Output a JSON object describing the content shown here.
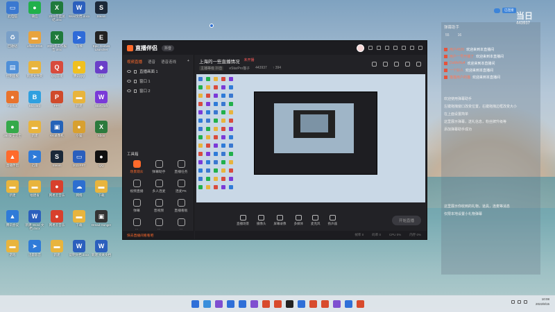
{
  "desktop": {
    "icons": [
      {
        "label": "此电脑",
        "color": "#3a78d0",
        "glyph": "▭"
      },
      {
        "label": "微信",
        "color": "#21b04b",
        "glyph": "●"
      },
      {
        "label": "2022年度总结.xlsx",
        "color": "#1f7a3c",
        "glyph": "X"
      },
      {
        "label": "Word文档.docx",
        "color": "#2b5fbd",
        "glyph": "W"
      },
      {
        "label": "Steam",
        "color": "#1b2838",
        "glyph": "S"
      },
      {
        "label": "回收站",
        "color": "#7aa0c8",
        "glyph": "♻"
      },
      {
        "label": "office 2016",
        "color": "#e8a33d",
        "glyph": "▬"
      },
      {
        "label": "2022年工作报告.xlsx",
        "color": "#1f7a3c",
        "glyph": "X"
      },
      {
        "label": "飞书",
        "color": "#2f6bd8",
        "glyph": "➤"
      },
      {
        "label": "Epic Games Launcher",
        "color": "#222",
        "glyph": "E"
      },
      {
        "label": "控制面板",
        "color": "#4f8fd8",
        "glyph": "▤"
      },
      {
        "label": "新建文件夹",
        "color": "#e8b43d",
        "glyph": "▬"
      },
      {
        "label": "QQ游戏",
        "color": "#d84b3d",
        "glyph": "Q"
      },
      {
        "label": "腾讯QQ",
        "color": "#f0c020",
        "glyph": "●"
      },
      {
        "label": "XXX",
        "color": "#6a3fc8",
        "glyph": "◆"
      },
      {
        "label": "Firefox",
        "color": "#e8732d",
        "glyph": "●"
      },
      {
        "label": "Blizzard",
        "color": "#2fa0e0",
        "glyph": "B"
      },
      {
        "label": "PPT",
        "color": "#d04a2b",
        "glyph": "P"
      },
      {
        "label": "新建",
        "color": "#e8b43d",
        "glyph": "▬"
      },
      {
        "label": "StarCraft",
        "color": "#7a3ad8",
        "glyph": "W"
      },
      {
        "label": "360安全卫士",
        "color": "#35a94a",
        "glyph": "●"
      },
      {
        "label": "新建",
        "color": "#e8b43d",
        "glyph": "▬"
      },
      {
        "label": "KK录像机",
        "color": "#2563b8",
        "glyph": "▣"
      },
      {
        "label": "小猫",
        "color": "#d8a030",
        "glyph": "●"
      },
      {
        "label": "Xbox",
        "color": "#2c7a3d",
        "glyph": "X"
      },
      {
        "label": "直播伴侣",
        "color": "#ff6a2b",
        "glyph": "▲"
      },
      {
        "label": "迅雷",
        "color": "#2f7bd8",
        "glyph": "➤"
      },
      {
        "label": "Steam",
        "color": "#1b2838",
        "glyph": "S"
      },
      {
        "label": "2022PPT",
        "color": "#2b5fbd",
        "glyph": "▭"
      },
      {
        "label": "QQ",
        "color": "#111",
        "glyph": "●"
      },
      {
        "label": "新建",
        "color": "#e8b43d",
        "glyph": "▬"
      },
      {
        "label": "福建省",
        "color": "#e8b43d",
        "glyph": "▬"
      },
      {
        "label": "网易云音乐",
        "color": "#d8402d",
        "glyph": "●"
      },
      {
        "label": "网络",
        "color": "#2c6fd0",
        "glyph": "☁"
      },
      {
        "label": "下载",
        "color": "#e8b43d",
        "glyph": "▬"
      },
      {
        "label": "腾讯会议",
        "color": "#2f7bd8",
        "glyph": "▲"
      },
      {
        "label": "新建 Word 文档.docx",
        "color": "#2b5fbd",
        "glyph": "W"
      },
      {
        "label": "网易云音乐",
        "color": "#d8402d",
        "glyph": "●"
      },
      {
        "label": "下载",
        "color": "#e8b43d",
        "glyph": "▬"
      },
      {
        "label": "Dread Hunger",
        "color": "#333",
        "glyph": "▣"
      },
      {
        "label": "游戏",
        "color": "#e8b43d",
        "glyph": "▬"
      },
      {
        "label": "迅雷影音",
        "color": "#2f7bd8",
        "glyph": "➤"
      },
      {
        "label": "新建",
        "color": "#e8b43d",
        "glyph": "▬"
      },
      {
        "label": "说明文档.docx",
        "color": "#2b5fbd",
        "glyph": "W"
      },
      {
        "label": "新建 文本文档",
        "color": "#2b5fbd",
        "glyph": "W"
      }
    ]
  },
  "window": {
    "app_name": "直播伴侣",
    "version_pill": "抖音",
    "left_tabs": [
      "视频直播",
      "语音",
      "语音连线"
    ],
    "scenes": [
      {
        "label": "直播画面 1"
      },
      {
        "label": "窗口 1"
      },
      {
        "label": "窗口 2"
      }
    ],
    "add_label": "+",
    "tools_heading": "工具箱",
    "tools": [
      {
        "label": "场景观众",
        "hot": true
      },
      {
        "label": "弹幕助手",
        "hot": false
      },
      {
        "label": "直播任务",
        "hot": false
      },
      {
        "label": "视频直播",
        "hot": false
      },
      {
        "label": "多人连麦",
        "hot": false
      },
      {
        "label": "连麦PK",
        "hot": false
      },
      {
        "label": "弹幕",
        "hot": false
      },
      {
        "label": "音视频",
        "hot": false
      },
      {
        "label": "直播看板",
        "hot": false
      },
      {
        "label": "…",
        "hot": false
      },
      {
        "label": "…",
        "hot": false
      },
      {
        "label": "…",
        "hot": false
      }
    ],
    "left_footer": "快去直播间看看吧",
    "room_title": "上海的一些直播情况",
    "room_live": "未开播",
    "room_meta": [
      "主播等级 抖音",
      "eStarPro猫子",
      "443937",
      "↑ 394"
    ],
    "bottom_tools": [
      "直播场景",
      "摄像头",
      "屏幕录像",
      "多媒体",
      "麦克风",
      "扬声器"
    ],
    "go_live": "开始直播",
    "status_items": [
      "帧率 0",
      "码率 0",
      "CPU 0%",
      "内存 0%"
    ]
  },
  "chat": {
    "heading": "弹幕助手",
    "stats": [
      "55",
      "16"
    ],
    "messages": [
      {
        "user": "用户4526",
        "text": "欢迎来到本直播间"
      },
      {
        "user": "用户一号开播了",
        "text": "欢迎来到本直播间"
      },
      {
        "user": "DuMeRu4",
        "text": "欢迎来到本直播间"
      },
      {
        "user": "一个好人",
        "text": "欢迎来到本直播间"
      },
      {
        "user": "猫猫用户的猫",
        "text": "欢迎来到本直播间"
      }
    ],
    "help_lines": [
      "欢迎使用弹幕助手",
      "左键拖拽窗口改变位置，右键拖拽边框改变大小",
      "在上面设置简单",
      "这里展示弹幕，送礼信息，粉丝牌升级等",
      "添加弹幕助手成功"
    ],
    "help_lines2": [
      "这里展示你收到的礼物，道具，连麦等消息",
      "仅限本地设置小礼物弹幕"
    ]
  },
  "overlay": {
    "counter_big": "当日",
    "counter_num": "443937",
    "top_btn": "已连接"
  },
  "taskbar": {
    "icons": [
      "#2f6fd8",
      "#3b8fdb",
      "#7f4fd0",
      "#2f6fd8",
      "#2f6fd8",
      "#7f4fd0",
      "#d84b2d",
      "#d84b2d",
      "#222",
      "#2f6fd8",
      "#d84b2d",
      "#d84b2d",
      "#7f4fd0",
      "#2f6fd8",
      "#d84b2d"
    ],
    "time": "10:08",
    "date": "2022/8/15"
  }
}
